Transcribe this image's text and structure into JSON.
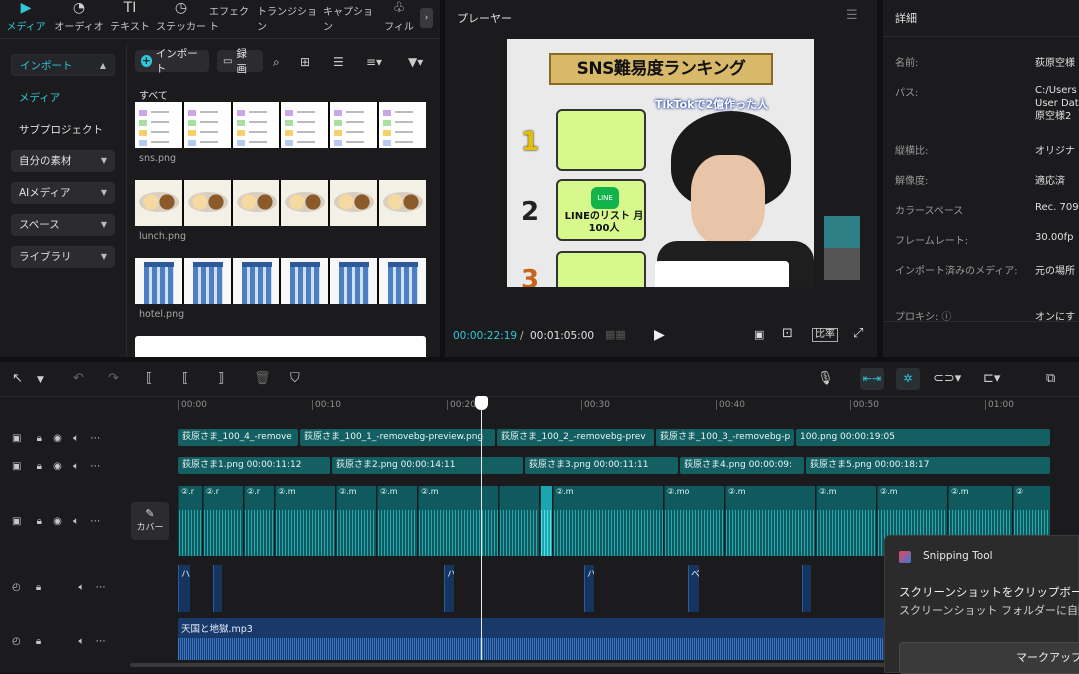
{
  "tabs": [
    {
      "label": "メディア",
      "icon": "media-icon"
    },
    {
      "label": "オーディオ",
      "icon": "audio-icon"
    },
    {
      "label": "テキスト",
      "icon": "text-icon"
    },
    {
      "label": "ステッカー",
      "icon": "sticker-icon"
    },
    {
      "label": "エフェクト",
      "icon": "effect-icon"
    },
    {
      "label": "トランジション",
      "icon": "transition-icon"
    },
    {
      "label": "キャプション",
      "icon": "caption-icon"
    },
    {
      "label": "フィル",
      "icon": "filter-icon"
    }
  ],
  "sidebar": {
    "import": "インポート",
    "media": "メディア",
    "subproject": "サブプロジェクト",
    "my_assets": "自分の素材",
    "ai_media": "AIメディア",
    "space": "スペース",
    "library": "ライブラリ"
  },
  "media_toolbar": {
    "import": "インポート",
    "record": "録画",
    "all": "すべて"
  },
  "media_files": [
    "sns.png",
    "lunch.png",
    "hotel.png"
  ],
  "player": {
    "title": "プレーヤー",
    "current_time": "00:00:22:19",
    "total_time": "00:01:05:00",
    "ratio_label": "比率",
    "video_title": "SNS難易度ランキング",
    "video_subtitle": "TikTokで2億作った人",
    "rank_numbers": [
      "1",
      "2",
      "3"
    ],
    "line_logo": "LINE",
    "line_text": "LINEのリスト 月100人"
  },
  "details": {
    "title": "詳細",
    "rows": [
      {
        "label": "名前:",
        "value": "荻原空様"
      },
      {
        "label": "パス:",
        "value": "C:/Users\nUser Dat\n原空様2"
      },
      {
        "label": "縦横比:",
        "value": "オリジナ"
      },
      {
        "label": "解像度:",
        "value": "適応済"
      },
      {
        "label": "カラースペース",
        "value": "Rec. 709"
      },
      {
        "label": "フレームレート:",
        "value": "30.00fp"
      },
      {
        "label": "インポート済みのメディア:",
        "value": "元の場所"
      },
      {
        "label": "プロキシ: ⓘ",
        "value": "オンにす"
      }
    ]
  },
  "ruler": [
    "00:00",
    "00:10",
    "00:20",
    "00:30",
    "00:40",
    "00:50",
    "01:00"
  ],
  "cover_label": "カバー",
  "track1_clips": [
    "荻原さま_100_4_-remove",
    "荻原さま_100_1_-removebg-preview.png",
    "荻原さま_100_2_-removebg-prev",
    "荻原さま_100_3_-removebg-p",
    "100.png",
    "00:00:19:05"
  ],
  "track2_clips": [
    {
      "name": "荻原さま1.png",
      "dur": "00:00:11:12"
    },
    {
      "name": "荻原さま2.png",
      "dur": "00:00:14:11"
    },
    {
      "name": "荻原さま3.png",
      "dur": "00:00:11:11"
    },
    {
      "name": "荻原さま4.png",
      "dur": "00:00:09:"
    },
    {
      "name": "荻原さま5.png",
      "dur": "00:00:18:17"
    }
  ],
  "video_clip_labels": [
    "②.r",
    "②.r",
    "②.r",
    "②.m",
    "②.m",
    "②.m",
    "②.m",
    "②.mo",
    "②.m",
    "②.m",
    "②.m",
    "②.m",
    "②.m",
    "②"
  ],
  "audio_clip_labels": [
    "ハ",
    "",
    "ハ",
    "ハ",
    "ベ",
    ""
  ],
  "music_label": "天国と地獄.mp3",
  "snipping": {
    "app": "Snipping Tool",
    "line1": "スクリーンショットをクリップボードに",
    "line2": "スクリーンショット フォルダーに自動",
    "button": "マークアップ"
  },
  "colors": {
    "accent": "#2ec8d8",
    "video_clip": "#145f62",
    "audio_clip": "#16355e"
  }
}
